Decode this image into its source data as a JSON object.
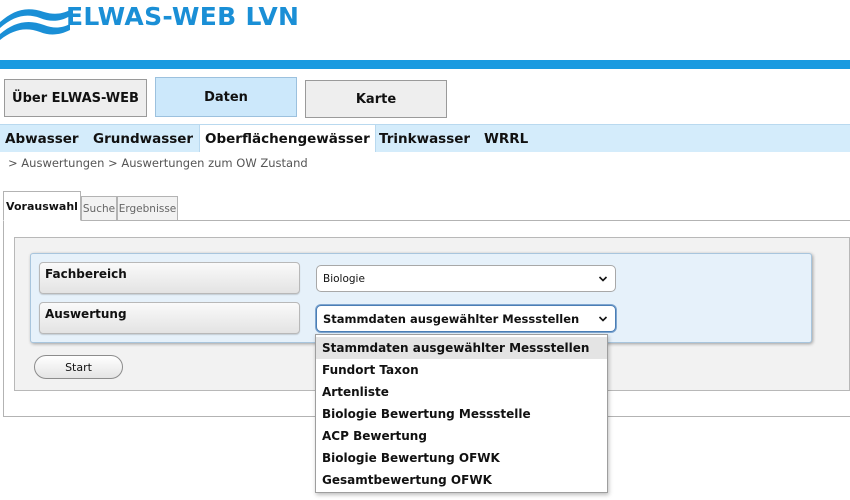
{
  "header": {
    "logo_text": "ELWAS-WEB LVN",
    "brand_color": "#1a8fd6",
    "bar_color": "#1a9ae0"
  },
  "mainnav": {
    "items": [
      {
        "label": "Über ELWAS-WEB",
        "active": false
      },
      {
        "label": "Daten",
        "active": true
      },
      {
        "label": "Karte",
        "active": false
      }
    ]
  },
  "subnav": {
    "items": [
      {
        "label": "Abwasser",
        "active": false
      },
      {
        "label": "Grundwasser",
        "active": false
      },
      {
        "label": "Oberflächengewässer",
        "active": true
      },
      {
        "label": "Trinkwasser",
        "active": false
      },
      {
        "label": "WRRL",
        "active": false
      }
    ]
  },
  "breadcrumb": "> Auswertungen > Auswertungen zum OW Zustand",
  "tabs": [
    {
      "label": "Vorauswahl",
      "active": true
    },
    {
      "label": "Suche",
      "active": false
    },
    {
      "label": "Ergebnisse",
      "active": false
    }
  ],
  "form": {
    "fachbereich_label": "Fachbereich",
    "fachbereich_value": "Biologie",
    "auswertung_label": "Auswertung",
    "auswertung_value": "Stammdaten ausgewählter Messstellen",
    "start_label": "Start"
  },
  "dropdown": {
    "options": [
      "Stammdaten ausgewählter Messstellen",
      "Fundort Taxon",
      "Artenliste",
      "Biologie Bewertung Messstelle",
      "ACP Bewertung",
      "Biologie Bewertung OFWK",
      "Gesamtbewertung OFWK"
    ],
    "selected_index": 0
  }
}
